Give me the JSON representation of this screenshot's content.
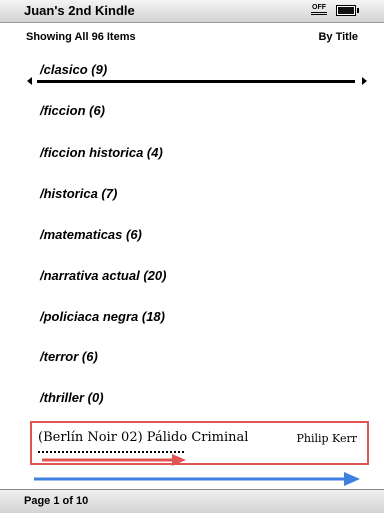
{
  "titlebar": {
    "device_name": "Juan's 2nd Kindle",
    "wifi_status": "OFF"
  },
  "listing": {
    "summary": "Showing All 96 Items",
    "sort_label": "By Title"
  },
  "collections": [
    {
      "label": "/clasico (9)",
      "selected": true
    },
    {
      "label": "/ficcion (6)"
    },
    {
      "label": "/ficcion historica (4)"
    },
    {
      "label": "/historica (7)"
    },
    {
      "label": "/matematicas (6)"
    },
    {
      "label": "/narrativa actual (20)"
    },
    {
      "label": "/policiaca negra (18)"
    },
    {
      "label": "/terror (6)"
    },
    {
      "label": "/thriller (0)"
    }
  ],
  "book": {
    "title": "(Berlín Noir 02) Pálido Criminal",
    "author": "Philip Kerr"
  },
  "annotation_colors": {
    "box": "#e05454",
    "red_arrow": "#e05454",
    "blue_arrow": "#3f7fe0"
  },
  "footer": {
    "page_indicator": "Page 1 of 10"
  }
}
